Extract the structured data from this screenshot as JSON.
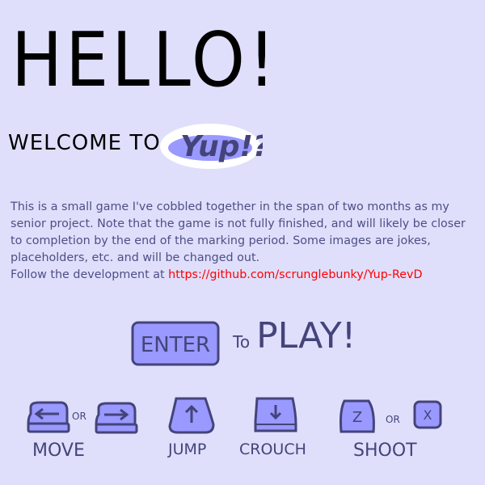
{
  "heading": "HELLO!",
  "welcome": "WELCOME TO",
  "logo_text": "Yup!?",
  "description": "This is a small game I've cobbled together in the span of two months as my senior project. Note that the game is not fully finished, and will likely be closer to completion by the end of the marking period. Some images are jokes, placeholders, etc. and will be changed out.",
  "follow_text": "Follow the development at ",
  "link": "https://github.com/scrunglebunky/Yup-RevD",
  "enter_key": "ENTER",
  "to": "To",
  "play": "PLAY!",
  "controls": {
    "or": "OR",
    "move": "MOVE",
    "jump": "JUMP",
    "crouch": "CROUCH",
    "shoot": "SHOOT",
    "z_key": "Z",
    "x_key": "X"
  },
  "colors": {
    "background": "#dfdffc",
    "key_fill": "#9999ff",
    "outline": "#44447a",
    "link": "#ff0000"
  }
}
